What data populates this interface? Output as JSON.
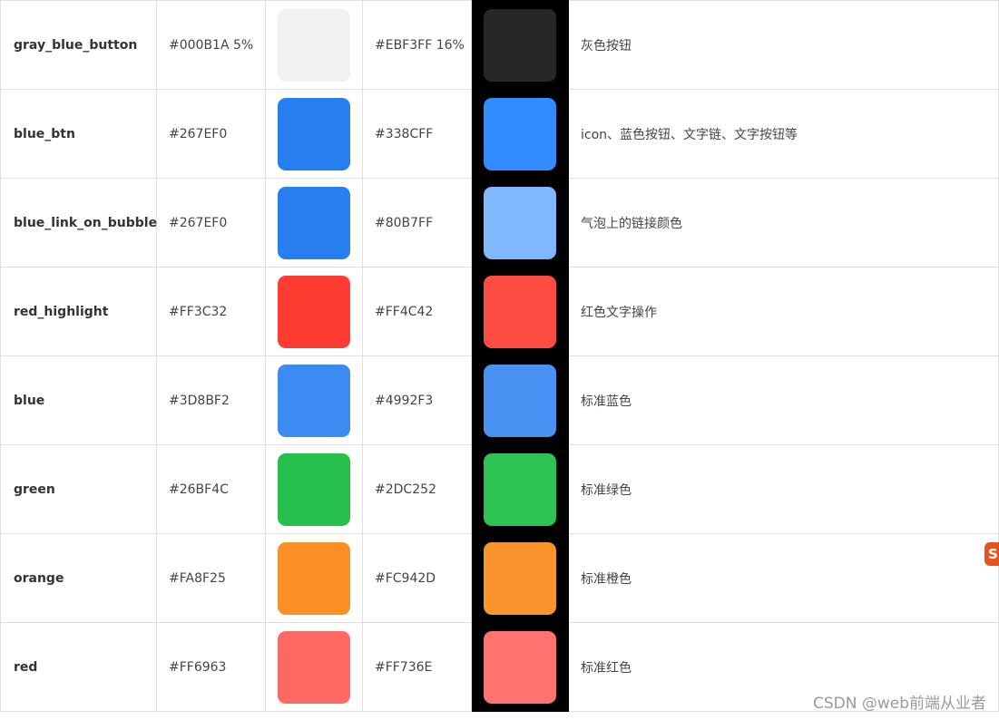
{
  "rows": [
    {
      "name": "gray_blue_button",
      "light_hex": "#000B1A 5%",
      "light_color": "#F1F1F1",
      "dark_hex": "#EBF3FF 16%",
      "dark_color": "#262729",
      "description": "灰色按钮"
    },
    {
      "name": "blue_btn",
      "light_hex": "#267EF0",
      "light_color": "#267EF0",
      "dark_hex": "#338CFF",
      "dark_color": "#338CFF",
      "description": "icon、蓝色按钮、文字链、文字按钮等"
    },
    {
      "name": "blue_link_on_bubble",
      "light_hex": "#267EF0",
      "light_color": "#267EF0",
      "dark_hex": "#80B7FF",
      "dark_color": "#80B7FF",
      "description": "气泡上的链接颜色"
    },
    {
      "name": "red_highlight",
      "light_hex": "#FF3C32",
      "light_color": "#FF3C32",
      "dark_hex": "#FF4C42",
      "dark_color": "#FF4C42",
      "description": "红色文字操作"
    },
    {
      "name": "blue",
      "light_hex": "#3D8BF2",
      "light_color": "#3D8BF2",
      "dark_hex": "#4992F3",
      "dark_color": "#4992F3",
      "description": "标准蓝色"
    },
    {
      "name": "green",
      "light_hex": "#26BF4C",
      "light_color": "#26BF4C",
      "dark_hex": "#2DC252",
      "dark_color": "#2DC252",
      "description": "标准绿色"
    },
    {
      "name": "orange",
      "light_hex": "#FA8F25",
      "light_color": "#FA8F25",
      "dark_hex": "#FC942D",
      "dark_color": "#FC942D",
      "description": "标准橙色"
    },
    {
      "name": "red",
      "light_hex": "#FF6963",
      "light_color": "#FF6963",
      "dark_hex": "#FF736E",
      "dark_color": "#FF736E",
      "description": "标准红色"
    }
  ],
  "watermark": "CSDN @web前端从业者",
  "edge_badge": {
    "label": "S",
    "icon": "sogou-ime-badge-icon",
    "color": "#E8521F"
  }
}
